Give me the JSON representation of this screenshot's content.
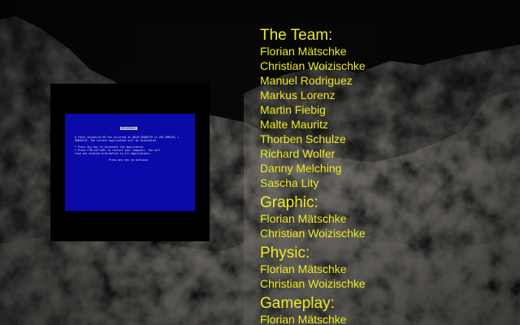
{
  "credits": {
    "sections": [
      {
        "title": "The Team:",
        "names": [
          "Florian Mätschke",
          "Christian Woizischke",
          "Manuel Rodriguez",
          "Markus Lorenz",
          "Martin Fiebig",
          "Malte Mauritz",
          "Thorben Schulze",
          "Richard Wolfer",
          "Danny Melching",
          "Sascha Lity"
        ]
      },
      {
        "title": "Graphic:",
        "names": [
          "Florian Mätschke",
          "Christian Woizischke"
        ]
      },
      {
        "title": "Physic:",
        "names": [
          "Florian Mätschke",
          "Christian Woizischke"
        ]
      },
      {
        "title": "Gameplay:",
        "names": [
          "Florian Mätschke"
        ]
      }
    ]
  },
  "bsod": {
    "title": "Windows",
    "lines": [
      "A fatal exception 0E has occurred at 0028:C0006270 in VxD VMM(01) +",
      "00005270. The current application will be terminated.",
      "",
      "* Press any key to terminate the application.",
      "* Press CTRL+ALT+DEL to restart your computer. You will",
      "  lose any unsaved information in all applications.",
      "",
      "Press any key to continue"
    ]
  },
  "colors": {
    "credits_text": "#ecec22",
    "bsod_background": "#0a0aa8",
    "monitor_frame": "#000000",
    "sky": "#0b0b0b"
  }
}
